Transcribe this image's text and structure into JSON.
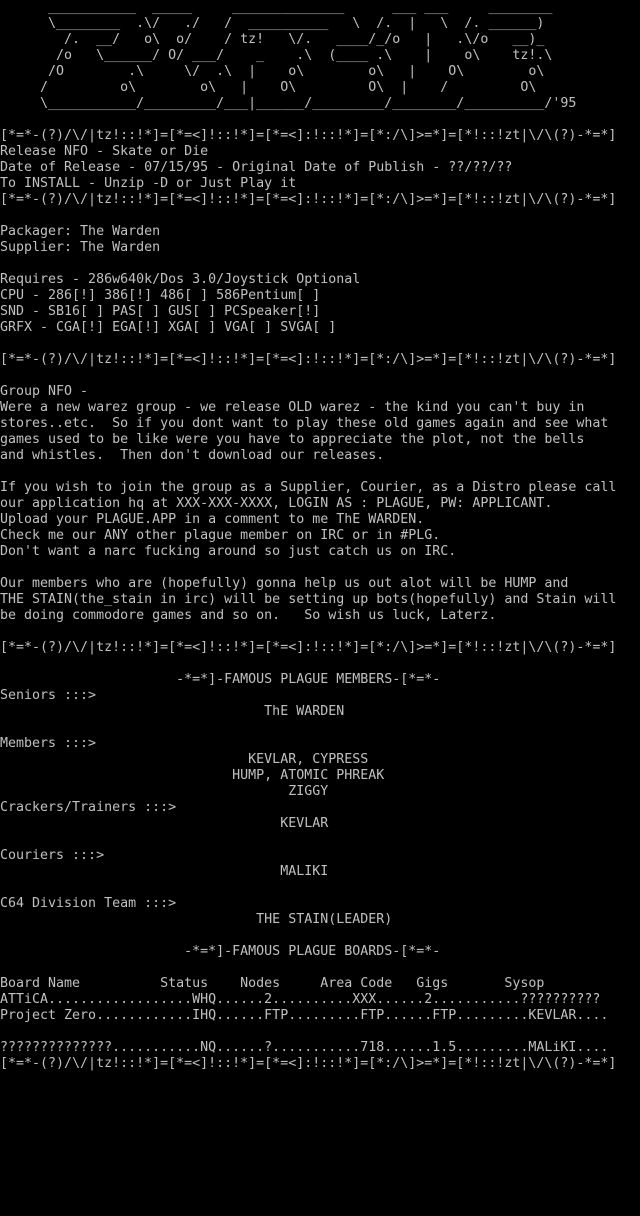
{
  "colors": {
    "background": "#000000",
    "text": "#c0c0c0"
  },
  "lines": [
    "      ___________  _____     ______________      ___ ___     ________",
    "      \\________  .\\/   ./   /  __________   \\  /.  |   \\  /. ______)",
    "        /.  __/   o\\  o/    / tz!   \\/.   ____/_/o   |   .\\/o   __)_",
    "       /o   \\______/ O/ ___/    _    .\\  (____ .\\    |    o\\    tz!.\\",
    "      /O        .\\     \\/  .\\  |    o\\        o\\   |    O\\        o\\",
    "     /         o\\        o\\   |    O\\         O\\  |    /         O\\",
    "     \\___________/_________/___|______/_________/________/__________/'95",
    "",
    "[*=*-(?)/\\/|tz!::!*]=[*=<]!::!*]=[*=<]:!::!*]=[*:/\\]>=*]=[*!::!zt|\\/\\(?)-*=*]",
    "Release NFO - Skate or Die",
    "Date of Release - 07/15/95 - Original Date of Publish - ??/??/??",
    "To INSTALL - Unzip -D or Just Play it",
    "[*=*-(?)/\\/|tz!::!*]=[*=<]!::!*]=[*=<]:!::!*]=[*:/\\]>=*]=[*!::!zt|\\/\\(?)-*=*]",
    "",
    "Packager: The Warden",
    "Supplier: The Warden",
    "",
    "Requires - 286w640k/Dos 3.0/Joystick Optional",
    "CPU - 286[!] 386[!] 486[ ] 586Pentium[ ]",
    "SND - SB16[ ] PAS[ ] GUS[ ] PCSpeaker[!]",
    "GRFX - CGA[!] EGA[!] XGA[ ] VGA[ ] SVGA[ ]",
    "",
    "[*=*-(?)/\\/|tz!::!*]=[*=<]!::!*]=[*=<]:!::!*]=[*:/\\]>=*]=[*!::!zt|\\/\\(?)-*=*]",
    "",
    "Group NFO -",
    "Were a new warez group - we release OLD warez - the kind you can't buy in",
    "stores..etc.  So if you dont want to play these old games again and see what",
    "games used to be like were you have to appreciate the plot, not the bells",
    "and whistles.  Then don't download our releases.",
    "",
    "If you wish to join the group as a Supplier, Courier, as a Distro please call",
    "our application hq at XXX-XXX-XXXX, LOGIN AS : PLAGUE, PW: APPLICANT.",
    "Upload your PLAGUE.APP in a comment to me ThE WARDEN.",
    "Check me our ANY other plague member on IRC or in #PLG.",
    "Don't want a narc fucking around so just catch us on IRC.",
    "",
    "Our members who are (hopefully) gonna help us out alot will be HUMP and",
    "THE STAIN(the_stain in irc) will be setting up bots(hopefully) and Stain will",
    "be doing commodore games and so on.   So wish us luck, Laterz.",
    "",
    "[*=*-(?)/\\/|tz!::!*]=[*=<]!::!*]=[*=<]:!::!*]=[*:/\\]>=*]=[*!::!zt|\\/\\(?)-*=*]",
    "",
    "                      -*=*]-FAMOUS PLAGUE MEMBERS-[*=*-",
    "Seniors :::>",
    "                                 ThE WARDEN",
    "",
    "Members :::>",
    "                               KEVLAR, CYPRESS",
    "                             HUMP, ATOMIC PHREAK",
    "                                    ZIGGY",
    "Crackers/Trainers :::>",
    "                                   KEVLAR",
    "",
    "Couriers :::>",
    "                                   MALIKI",
    "",
    "C64 Division Team :::>",
    "                                THE STAIN(LEADER)",
    "",
    "                       -*=*]-FAMOUS PLAGUE BOARDS-[*=*-",
    "",
    "Board Name          Status    Nodes     Area Code   Gigs       Sysop",
    "ATTiCA..................WHQ......2..........XXX......2...........??????????",
    "Project Zero............IHQ......FTP.........FTP......FTP.........KEVLAR....",
    "",
    "??????????????...........NQ......?...........718......1.5.........MALiKI....",
    "[*=*-(?)/\\/|tz!::!*]=[*=<]!::!*]=[*=<]:!::!*]=[*:/\\]>=*]=[*!::!zt|\\/\\(?)-*=*]"
  ]
}
